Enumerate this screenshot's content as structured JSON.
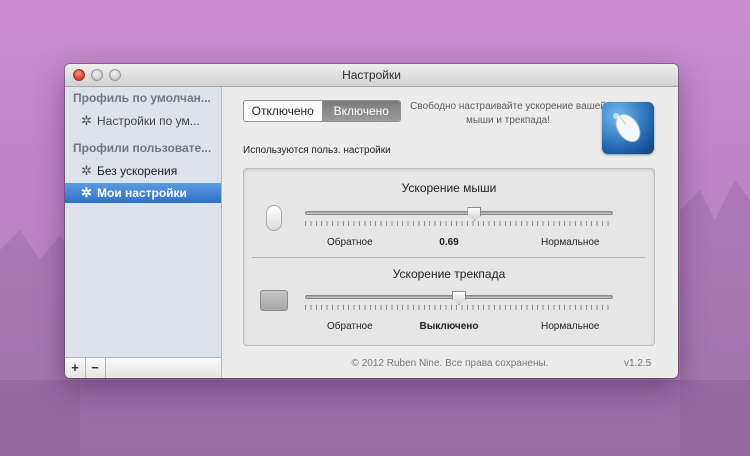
{
  "window": {
    "title": "Настройки"
  },
  "sidebar": {
    "default_header": "Профиль по умолчан...",
    "default_items": [
      {
        "label": "Настройки по ум..."
      }
    ],
    "user_header": "Профили пользовате...",
    "user_items": [
      {
        "label": "Без ускорения",
        "selected": false
      },
      {
        "label": "Мои настройки",
        "selected": true
      }
    ],
    "add_label": "+",
    "remove_label": "−"
  },
  "main": {
    "toggle": {
      "off_label": "Отключено",
      "on_label": "Включено",
      "selected": "on"
    },
    "tagline": "Свободно настраивайте ускорение вашей мыши и трекпада!",
    "using_text": "Используются польз. настройки",
    "mouse": {
      "title": "Ускорение мыши",
      "left_label": "Обратное",
      "value_label": "0.69",
      "right_label": "Нормальное",
      "slider_fraction": 0.55
    },
    "trackpad": {
      "title": "Ускорение трекпада",
      "left_label": "Обратное",
      "value_label": "Выключено",
      "right_label": "Нормальное",
      "slider_fraction": 0.5
    },
    "copyright": "© 2012 Ruben Nine. Все права сохранены.",
    "version": "v1.2.5"
  },
  "icons": {
    "gear": "gear-icon",
    "app": "mouse-app-icon",
    "mouse": "mouse-icon",
    "trackpad": "trackpad-icon"
  },
  "colors": {
    "selection": "#2f6fc9",
    "desktop": "#c98fcf"
  }
}
